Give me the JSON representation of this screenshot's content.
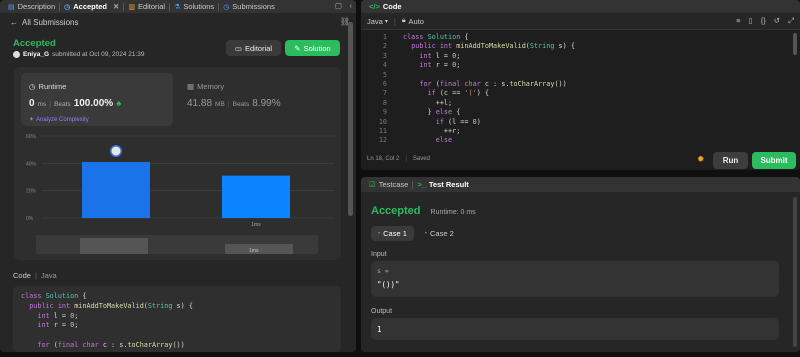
{
  "left_tabs": [
    {
      "label": "Description",
      "icon": "description-icon",
      "active": false
    },
    {
      "label": "Accepted",
      "icon": "history-icon",
      "active": true
    },
    {
      "label": "Editorial",
      "icon": "book-icon",
      "active": false
    },
    {
      "label": "Solutions",
      "icon": "flask-icon",
      "active": false
    },
    {
      "label": "Submissions",
      "icon": "history-icon",
      "active": false
    }
  ],
  "submission": {
    "back_label": "All Submissions",
    "status": "Accepted",
    "user": "Eniya_G",
    "submitted_text": "submitted at Oct 09, 2024 21:39",
    "editorial_label": "Editorial",
    "solution_label": "Solution"
  },
  "runtime": {
    "label": "Runtime",
    "value": "0",
    "unit": "ms",
    "beats_label": "Beats",
    "beats": "100.00%",
    "analyze_label": "Analyze Complexity"
  },
  "memory": {
    "label": "Memory",
    "value": "41.88",
    "unit": "MB",
    "beats_label": "Beats",
    "beats": "8.99%"
  },
  "chart_data": {
    "type": "bar",
    "yticks": [
      "60%",
      "40%",
      "20%",
      "0%"
    ],
    "ylim": [
      0,
      60
    ],
    "bars": [
      {
        "label": "",
        "value": 41
      },
      {
        "label": "1ms",
        "value": 31
      }
    ],
    "nav_label": "1ms"
  },
  "code_section": {
    "tab_code": "Code",
    "tab_lang": "Java"
  },
  "left_code_lines": [
    "class Solution {",
    "  public int minAddToMakeValid(String s) {",
    "    int l = 0;",
    "    int r = 0;",
    "",
    "    for (final char c : s.toCharArray())"
  ],
  "editor": {
    "title": "Code",
    "language": "Java",
    "mode": "Auto",
    "status": "Ln 18, Col 2",
    "saved": "Saved",
    "run_label": "Run",
    "submit_label": "Submit",
    "lines": [
      "class Solution {",
      "  public int minAddToMakeValid(String s) {",
      "    int l = 0;",
      "    int r = 0;",
      "",
      "    for (final char c : s.toCharArray())",
      "      if (c == '(') {",
      "        ++l;",
      "      } else {",
      "        if (l == 0)",
      "          ++r;",
      "        else"
    ]
  },
  "testpanel": {
    "tab_testcase": "Testcase",
    "tab_result": "Test Result",
    "status": "Accepted",
    "runtime": "Runtime: 0 ms",
    "case1": "Case 1",
    "case2": "Case 2",
    "input_label": "Input",
    "input_var": "s =",
    "input_value": "\"())\"",
    "output_label": "Output",
    "output_value": "1"
  },
  "colors": {
    "accent_green": "#2cbb5d",
    "blue": "#1a73e8",
    "chart_blue": "#0a84ff"
  }
}
